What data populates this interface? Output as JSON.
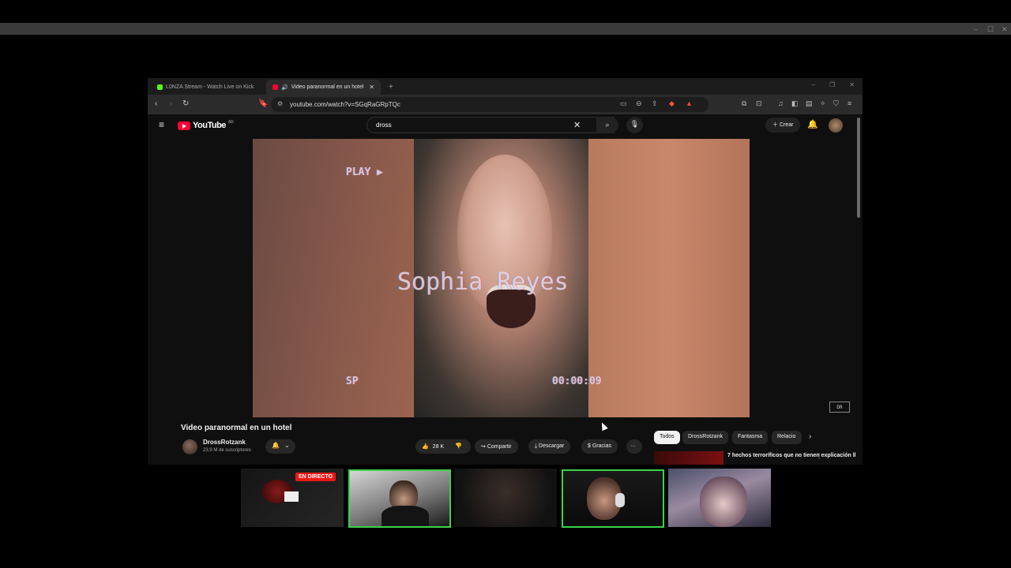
{
  "outer_window": {
    "controls": [
      "–",
      "☐",
      "✕"
    ]
  },
  "browser": {
    "tabs": [
      {
        "label": "L0NZA Stream - Watch Live on Kick",
        "favicon_color": "#53fc18"
      },
      {
        "label": "Video paranormal en un hotel",
        "favicon_color": "#ff0033"
      }
    ],
    "new_tab": "+",
    "window_controls": [
      "–",
      "❐",
      "✕"
    ],
    "url": "youtube.com/watch?v=SGqRaGRpTQc"
  },
  "youtube": {
    "logo_text": "YouTube",
    "logo_region": "AR",
    "search_value": "dross",
    "create_label": "Crear",
    "video": {
      "overlay_name": "Sophia Reyes",
      "overlay_play": "PLAY ▶",
      "overlay_sp": "SP",
      "overlay_time": "00:00:09",
      "watermark": "DR"
    },
    "title": "Video paranormal en un hotel",
    "channel": "DrossRotzank",
    "subscribers": "23,9 M de suscriptores",
    "likes": "28 K",
    "share_label": "Compartir",
    "download_label": "Descargar",
    "thanks_label": "Gracias",
    "more_label": "···",
    "chips": [
      "Todos",
      "DrossRotzank",
      "Fantasma",
      "Relacio"
    ],
    "rec_title": "7 hechos terroríficos que no tienen explicación ll"
  },
  "stream": {
    "live_badge": "EN DIRECTO"
  },
  "colors": {
    "yt_red": "#ff0033",
    "live_red": "#e91916",
    "highlight_green": "#3bd24a"
  }
}
